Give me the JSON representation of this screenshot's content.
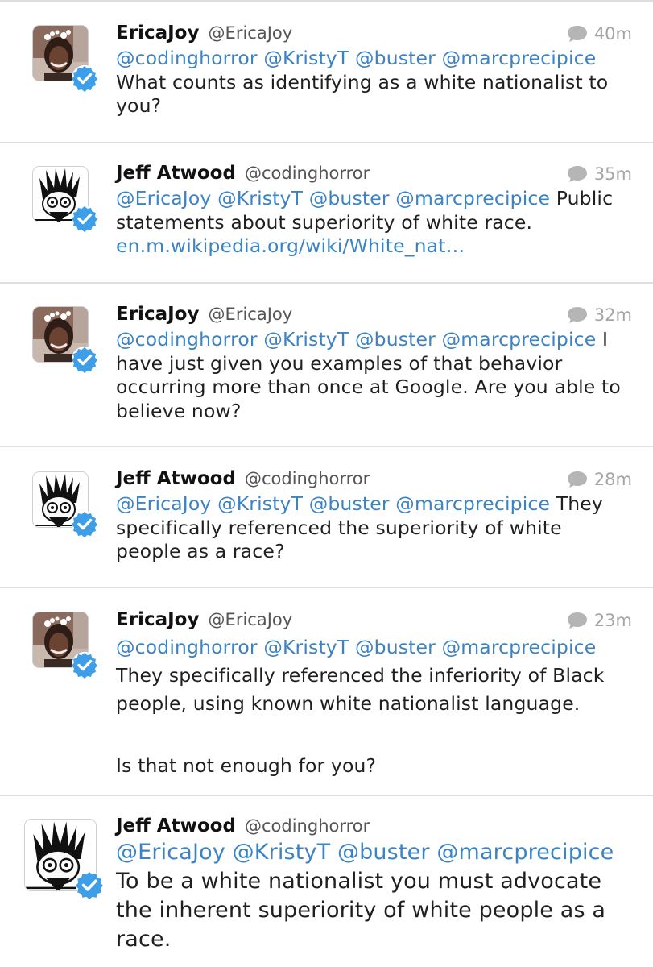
{
  "tweets": [
    {
      "name": "EricaJoy",
      "handle": "@EricaJoy",
      "time": "40m",
      "mentions": [
        "@codinghorror",
        "@KristyT",
        "@buster",
        "@marcprecipice"
      ],
      "text": "What counts as identifying as a white nationalist to you?"
    },
    {
      "name": "Jeff Atwood",
      "handle": "@codinghorror",
      "time": "35m",
      "mentions": [
        "@EricaJoy",
        "@KristyT",
        "@buster",
        "@marcprecipice"
      ],
      "text": "Public statements about superiority of white race.",
      "link": "en.m.wikipedia.org/wiki/White_nat…"
    },
    {
      "name": "EricaJoy",
      "handle": "@EricaJoy",
      "time": "32m",
      "mentions": [
        "@codinghorror",
        "@KristyT",
        "@buster",
        "@marcprecipice"
      ],
      "text": "I have just given you examples of that behavior occurring more than once at Google. Are you able to believe now?"
    },
    {
      "name": "Jeff Atwood",
      "handle": "@codinghorror",
      "time": "28m",
      "mentions": [
        "@EricaJoy",
        "@KristyT",
        "@buster",
        "@marcprecipice"
      ],
      "text": "They specifically referenced the superiority of white people as a race?"
    },
    {
      "name": "EricaJoy",
      "handle": "@EricaJoy",
      "time": "23m",
      "mentions": [
        "@codinghorror",
        "@KristyT",
        "@buster",
        "@marcprecipice"
      ],
      "text": "They specifically referenced the inferiority of Black people, using known white nationalist language.",
      "text2": "Is that not enough for you?"
    },
    {
      "name": "Jeff Atwood",
      "handle": "@codinghorror",
      "mentions": [
        "@EricaJoy",
        "@KristyT",
        "@buster",
        "@marcprecipice"
      ],
      "text": "To be a white nationalist you must advocate the inherent superiority of white people as a race."
    }
  ],
  "icons": {
    "reply": "reply-bubble-icon",
    "verified": "verified-badge-icon"
  },
  "colors": {
    "mention": "#3b83c4",
    "verified": "#3f9ee8",
    "divider": "#dedede",
    "meta": "#a5a5a5"
  }
}
